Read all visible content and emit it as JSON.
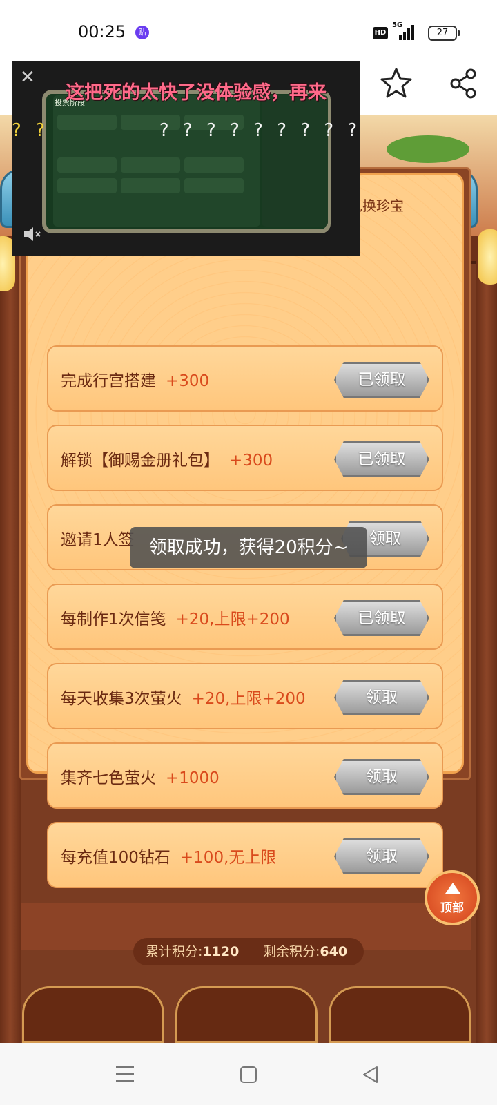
{
  "status": {
    "time": "00:25",
    "notification_badge": "贴",
    "hd": "HD",
    "network": "5G",
    "battery": "27"
  },
  "video": {
    "danmaku": "这把死的太快了没体验感，再来",
    "panel_stage": "投票阶段",
    "question_marks_yellow": "? ?",
    "question_marks_white": "? ? ? ? ? ? ? ? ?"
  },
  "board": {
    "intro": "整个周年庆期间完成指定任务获取积分，可兑换珍宝",
    "tasks": [
      {
        "name": "完成行宫搭建",
        "points": "+300",
        "button": "已领取"
      },
      {
        "name": "解锁【御赐金册礼包】",
        "points": "+300",
        "button": "已领取"
      },
      {
        "name": "邀请1人签",
        "points": "",
        "button": "领取"
      },
      {
        "name": "每制作1次信笺",
        "points": "+20,上限+200",
        "button": "已领取"
      },
      {
        "name": "每天收集3次萤火",
        "points": "+20,上限+200",
        "button": "领取"
      },
      {
        "name": "集齐七色萤火",
        "points": "+1000",
        "button": "领取"
      },
      {
        "name": "每充值100钻石",
        "points": "+100,无上限",
        "button": "领取"
      }
    ]
  },
  "toast": "领取成功，获得20积分~",
  "totals": {
    "cumulative_label": "累计积分:",
    "cumulative_value": "1120",
    "remaining_label": "剩余积分:",
    "remaining_value": "640"
  },
  "top_button": "顶部",
  "colors": {
    "accent": "#d94a1c",
    "text_brown": "#6b2a12",
    "board": "#ffce8a",
    "wood": "#7a3c22"
  }
}
